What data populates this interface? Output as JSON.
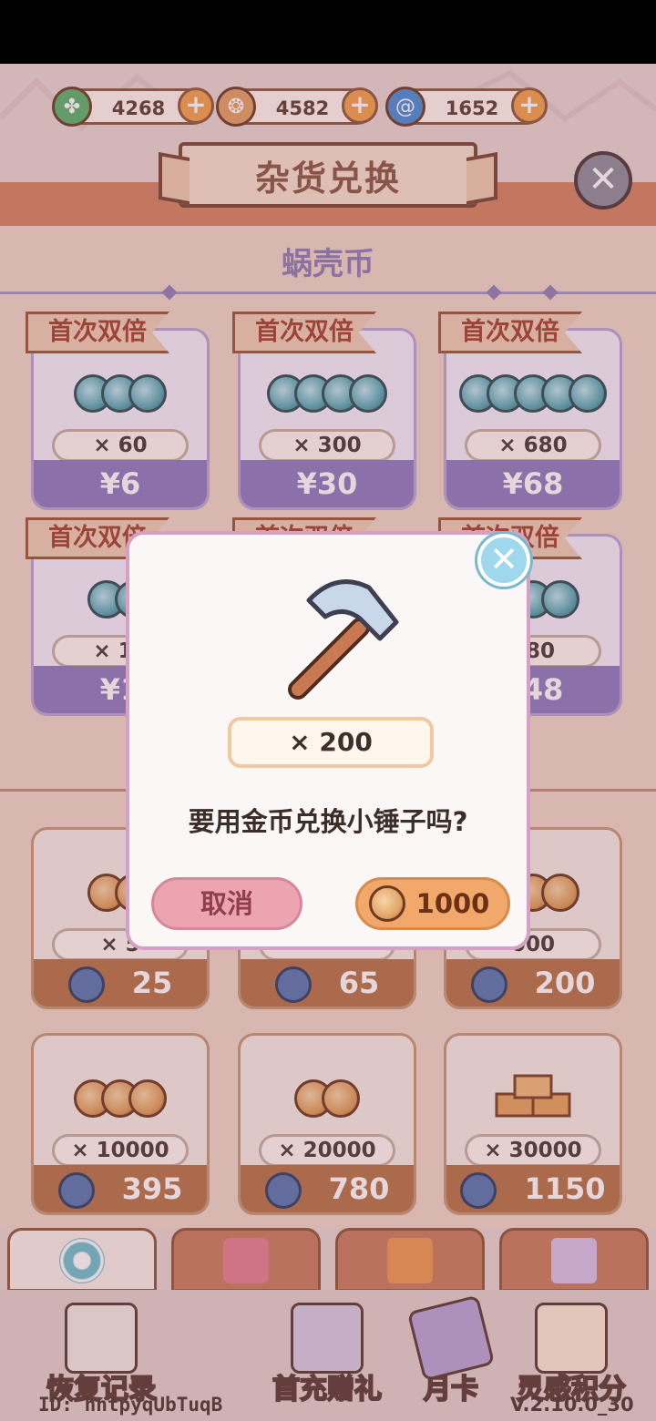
{
  "currencies": [
    {
      "icon": "clover-icon",
      "value": "4268",
      "color": "#58b06a"
    },
    {
      "icon": "gold-coin-icon",
      "value": "4582",
      "color": "#e3a164"
    },
    {
      "icon": "spiral-shell-icon",
      "value": "1652",
      "color": "#4a8fd6"
    }
  ],
  "header": {
    "title": "杂货兑换"
  },
  "section": {
    "title": "蜗壳币"
  },
  "shell_items": [
    {
      "ribbon": "首次双倍",
      "qty": "× 60",
      "price": "¥6"
    },
    {
      "ribbon": "首次双倍",
      "qty": "× 300",
      "price": "¥30"
    },
    {
      "ribbon": "首次双倍",
      "qty": "× 680",
      "price": "¥68"
    },
    {
      "ribbon": "首次双倍",
      "qty": "× 12",
      "price": "¥1"
    },
    {
      "ribbon": "首次双倍",
      "qty": "",
      "price": ""
    },
    {
      "ribbon": "首次双倍",
      "qty": "480",
      "price": "648"
    }
  ],
  "gold_items": [
    {
      "qty": "× 5",
      "price": "25"
    },
    {
      "qty": "",
      "price": "65"
    },
    {
      "qty": "000",
      "price": "200"
    },
    {
      "qty": "× 10000",
      "price": "395"
    },
    {
      "qty": "× 20000",
      "price": "780"
    },
    {
      "qty": "× 30000",
      "price": "1150"
    }
  ],
  "dialog": {
    "item_icon": "hammer-icon",
    "amount": "× 200",
    "question": "要用金币兑换小锤子吗?",
    "cancel_label": "取消",
    "confirm_price": "1000"
  },
  "tabs": [
    {
      "icon": "spiral-icon",
      "active": true
    },
    {
      "icon": "shirt-icon",
      "active": false
    },
    {
      "icon": "gift-icon",
      "active": false
    },
    {
      "icon": "scroll-icon",
      "active": false
    }
  ],
  "bottom_nav": [
    {
      "label": "恢复记录",
      "icon": "clipboard-icon"
    },
    {
      "label": "首充赠礼",
      "icon": "gift-box-icon"
    },
    {
      "label": "月卡",
      "icon": "card-icon"
    },
    {
      "label": "灵感积分",
      "icon": "lightbulb-icon"
    }
  ],
  "footer": {
    "id_text": "ID: hntpyqUbTuqB",
    "version": "V.2.10.0_30"
  }
}
